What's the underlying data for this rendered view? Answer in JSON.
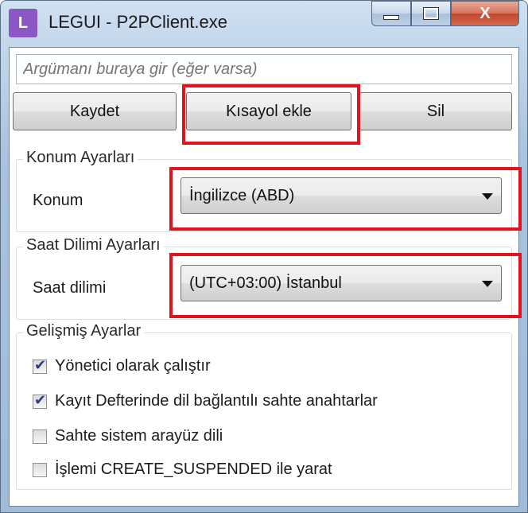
{
  "window": {
    "app_icon_letter": "L",
    "title": "LEGUI - P2PClient.exe",
    "close_glyph": "X"
  },
  "arguments": {
    "placeholder": "Argümanı buraya gir (eğer varsa)"
  },
  "toolbar": {
    "save_label": "Kaydet",
    "shortcut_label": "Kısayol ekle",
    "delete_label": "Sil"
  },
  "location_group": {
    "legend": "Konum Ayarları",
    "label": "Konum",
    "selected": "İngilizce (ABD)"
  },
  "timezone_group": {
    "legend": "Saat Dilimi Ayarları",
    "label": "Saat dilimi",
    "selected": "(UTC+03:00) İstanbul"
  },
  "advanced_group": {
    "legend": "Gelişmiş Ayarlar",
    "options": [
      {
        "label": "Yönetici olarak çalıştır",
        "checked": true
      },
      {
        "label": "Kayıt Defterinde dil bağlantılı sahte anahtarlar",
        "checked": true
      },
      {
        "label": "Sahte sistem arayüz dili",
        "checked": false
      },
      {
        "label": "İşlemi CREATE_SUSPENDED ile yarat",
        "checked": false
      }
    ]
  },
  "annotation_color": "#e3131e"
}
